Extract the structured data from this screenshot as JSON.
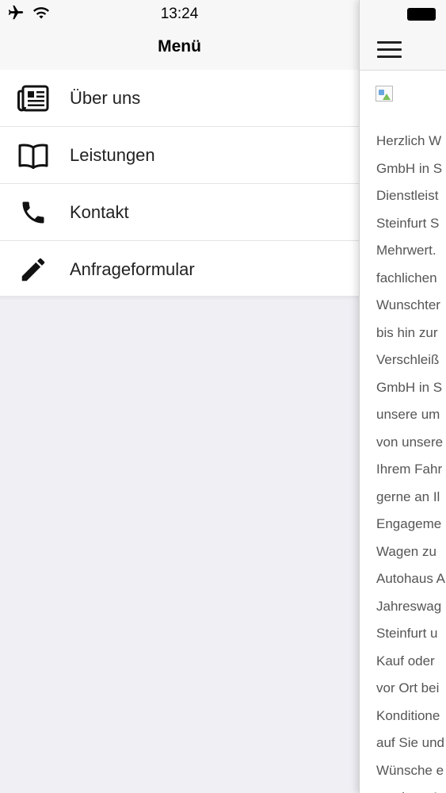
{
  "status_bar": {
    "time": "13:24",
    "icons": [
      "airplane-icon",
      "wifi-icon",
      "battery-icon"
    ]
  },
  "menu": {
    "title": "Menü",
    "items": [
      {
        "label": "Über uns",
        "icon": "newspaper-icon"
      },
      {
        "label": "Leistungen",
        "icon": "book-icon"
      },
      {
        "label": "Kontakt",
        "icon": "phone-icon"
      },
      {
        "label": "Anfrageformular",
        "icon": "pencil-icon"
      }
    ]
  },
  "content": {
    "nav_icon": "hamburger-menu-icon",
    "lines": [
      "Herzlich W",
      "GmbH in S",
      "Dienstleist",
      "Steinfurt S",
      "Mehrwert.",
      "fachlichen",
      "Wunschter",
      "bis hin zur",
      "Verschleiß",
      "GmbH in S",
      "unsere um",
      "von unsere",
      "Ihrem Fahr",
      "gerne an Il",
      "Engageme",
      "Wagen zu",
      "Autohaus A",
      "Jahreswag",
      "Steinfurt u",
      "Kauf oder",
      "vor Ort bei",
      "Konditione",
      "auf Sie und",
      "Wünsche e",
      "machen. A"
    ]
  },
  "colors": {
    "bar_background": "#f7f7f7",
    "page_background": "#efeff4",
    "text": "#222222",
    "body_text": "#555555"
  }
}
